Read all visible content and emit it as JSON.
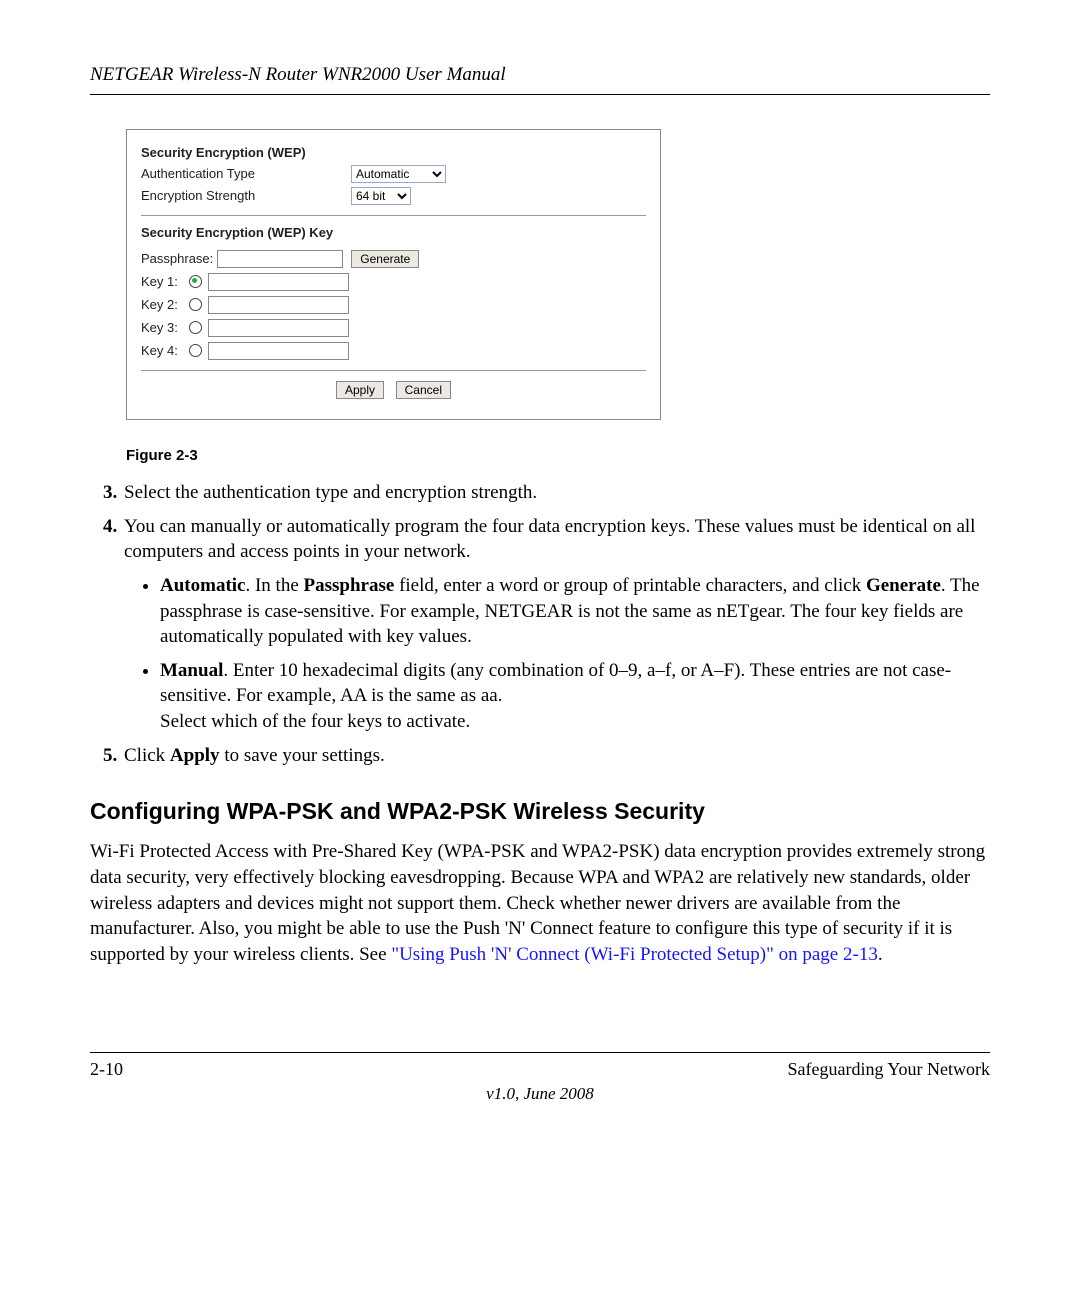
{
  "header": {
    "title": "NETGEAR Wireless-N Router WNR2000 User Manual"
  },
  "panel": {
    "section_wep": "Security Encryption (WEP)",
    "auth_label": "Authentication Type",
    "auth_value": "Automatic",
    "enc_label": "Encryption Strength",
    "enc_value": "64 bit",
    "section_key": "Security Encryption (WEP) Key",
    "pass_label": "Passphrase:",
    "generate_label": "Generate",
    "keys": [
      {
        "label": "Key 1:",
        "selected": true
      },
      {
        "label": "Key 2:",
        "selected": false
      },
      {
        "label": "Key 3:",
        "selected": false
      },
      {
        "label": "Key 4:",
        "selected": false
      }
    ],
    "apply_label": "Apply",
    "cancel_label": "Cancel"
  },
  "figure_label": "Figure 2-3",
  "steps": {
    "s3": "Select the authentication type and encryption strength.",
    "s4_lead": "You can manually or automatically program the four data encryption keys. These values must be identical on all computers and access points in your network.",
    "auto_bold": "Automatic",
    "auto_mid_pre": ". In the ",
    "auto_pass_bold": "Passphrase",
    "auto_mid_post": " field, enter a word or group of printable characters, and click ",
    "auto_gen_bold": "Generate",
    "auto_tail": ". The passphrase is case-sensitive. For example, NETGEAR is not the same as nETgear. The four key fields are automatically populated with key values.",
    "manual_bold": "Manual",
    "manual_tail": ". Enter 10 hexadecimal digits (any combination of 0–9, a–f, or A–F). These entries are not case-sensitive. For example, AA is the same as aa.",
    "manual_select": "Select which of the four keys to activate.",
    "s5_pre": "Click ",
    "s5_apply_bold": "Apply",
    "s5_post": " to save your settings."
  },
  "section_heading": "Configuring WPA-PSK and WPA2-PSK Wireless Security",
  "wpa_para_pre": "Wi-Fi Protected Access with Pre-Shared Key (WPA-PSK and WPA2-PSK) data encryption provides extremely strong data security, very effectively blocking eavesdropping. Because WPA and WPA2 are relatively new standards, older wireless adapters and devices might not support them. Check whether newer drivers are available from the manufacturer. Also, you might be able to use the Push 'N' Connect feature to configure this type of security if it is supported by your wireless clients. See ",
  "wpa_link": "\"Using Push 'N' Connect (Wi-Fi Protected Setup)\" on page 2-13",
  "wpa_para_post": ".",
  "footer": {
    "page": "2-10",
    "section": "Safeguarding Your Network",
    "version": "v1.0, June 2008"
  }
}
